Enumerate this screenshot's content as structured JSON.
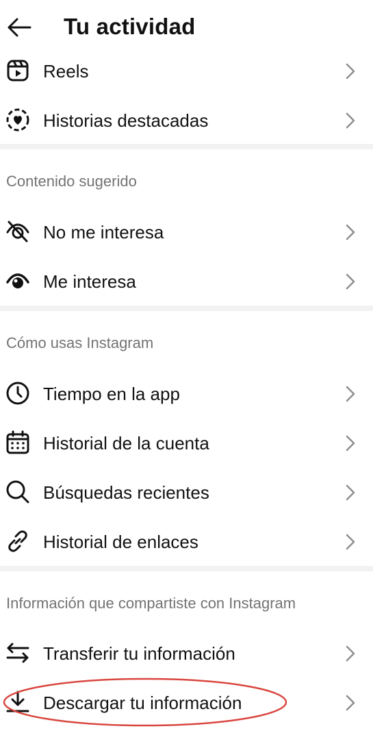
{
  "header": {
    "title": "Tu actividad",
    "back_icon": "arrow-left-icon"
  },
  "sections": [
    {
      "title": "",
      "items": [
        {
          "label": "Reels",
          "icon": "reels-icon"
        },
        {
          "label": "Historias destacadas",
          "icon": "highlights-icon"
        }
      ]
    },
    {
      "title": "Contenido sugerido",
      "items": [
        {
          "label": "No me interesa",
          "icon": "eye-off-icon"
        },
        {
          "label": "Me interesa",
          "icon": "eye-icon"
        }
      ]
    },
    {
      "title": "Cómo usas Instagram",
      "items": [
        {
          "label": "Tiempo en la app",
          "icon": "clock-icon"
        },
        {
          "label": "Historial de la cuenta",
          "icon": "calendar-icon"
        },
        {
          "label": "Búsquedas recientes",
          "icon": "search-icon"
        },
        {
          "label": "Historial de enlaces",
          "icon": "link-icon"
        }
      ]
    },
    {
      "title": "Información que compartiste con Instagram",
      "items": [
        {
          "label": "Transferir tu información",
          "icon": "transfer-arrows-icon"
        },
        {
          "label": "Descargar tu información",
          "icon": "download-icon"
        }
      ]
    }
  ],
  "annotation": {
    "type": "ellipse",
    "color": "#d9463e",
    "target": "Descargar tu información"
  }
}
